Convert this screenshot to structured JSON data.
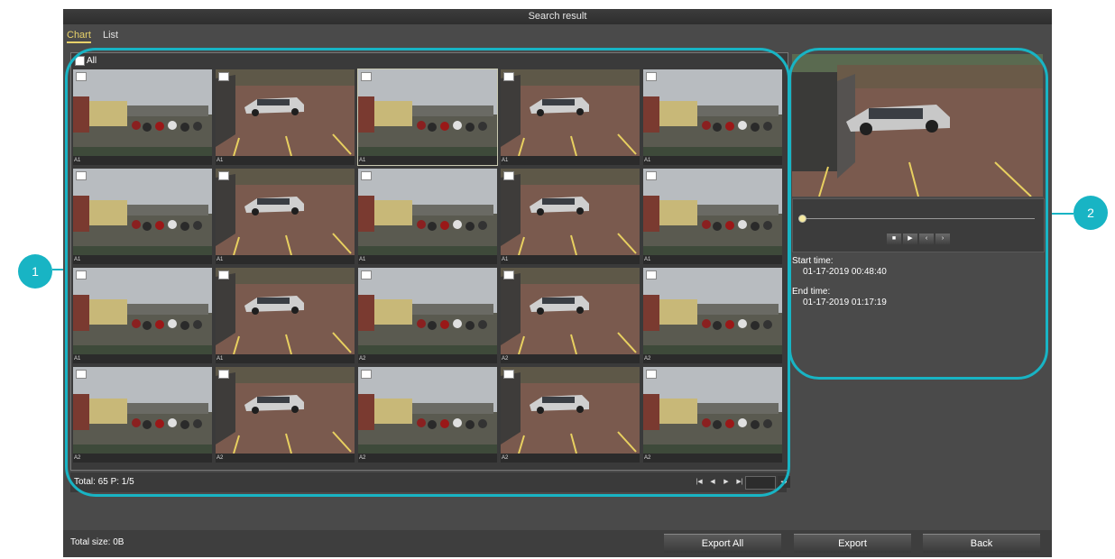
{
  "window": {
    "title": "Search result"
  },
  "tabs": [
    {
      "label": "Chart",
      "active": true
    },
    {
      "label": "List",
      "active": false
    }
  ],
  "grid": {
    "select_all_label": "All",
    "thumbnails": [
      {
        "camera": "A1",
        "scene": "lot",
        "selected": false
      },
      {
        "camera": "A1",
        "scene": "van",
        "selected": false
      },
      {
        "camera": "A1",
        "scene": "lot",
        "selected": true
      },
      {
        "camera": "A1",
        "scene": "van",
        "selected": false
      },
      {
        "camera": "A1",
        "scene": "lot",
        "selected": false
      },
      {
        "camera": "A1",
        "scene": "lot",
        "selected": false
      },
      {
        "camera": "A1",
        "scene": "van",
        "selected": false
      },
      {
        "camera": "A1",
        "scene": "lot",
        "selected": false
      },
      {
        "camera": "A1",
        "scene": "van",
        "selected": false
      },
      {
        "camera": "A1",
        "scene": "lot",
        "selected": false
      },
      {
        "camera": "A1",
        "scene": "lot",
        "selected": false
      },
      {
        "camera": "A1",
        "scene": "van",
        "selected": false
      },
      {
        "camera": "A2",
        "scene": "lot",
        "selected": false
      },
      {
        "camera": "A2",
        "scene": "van",
        "selected": false
      },
      {
        "camera": "A2",
        "scene": "lot",
        "selected": false
      },
      {
        "camera": "A2",
        "scene": "lot",
        "selected": false
      },
      {
        "camera": "A2",
        "scene": "van",
        "selected": false
      },
      {
        "camera": "A2",
        "scene": "lot",
        "selected": false
      },
      {
        "camera": "A2",
        "scene": "van",
        "selected": false
      },
      {
        "camera": "A2",
        "scene": "lot",
        "selected": false
      }
    ],
    "footer": {
      "total_text": "Total: 65  P: 1/5"
    }
  },
  "playback": {
    "start_label": "Start time:",
    "start_value": "01-17-2019 00:48:40",
    "end_label": "End time:",
    "end_value": "01-17-2019 01:17:19"
  },
  "bottom": {
    "total_size": "Total size: 0B",
    "export_all": "Export All",
    "export": "Export",
    "back": "Back"
  },
  "callouts": {
    "one": "1",
    "two": "2"
  },
  "colors": {
    "accent": "#18b4c4",
    "tab_active": "#e8d26a",
    "panel": "#4a4a4a"
  }
}
